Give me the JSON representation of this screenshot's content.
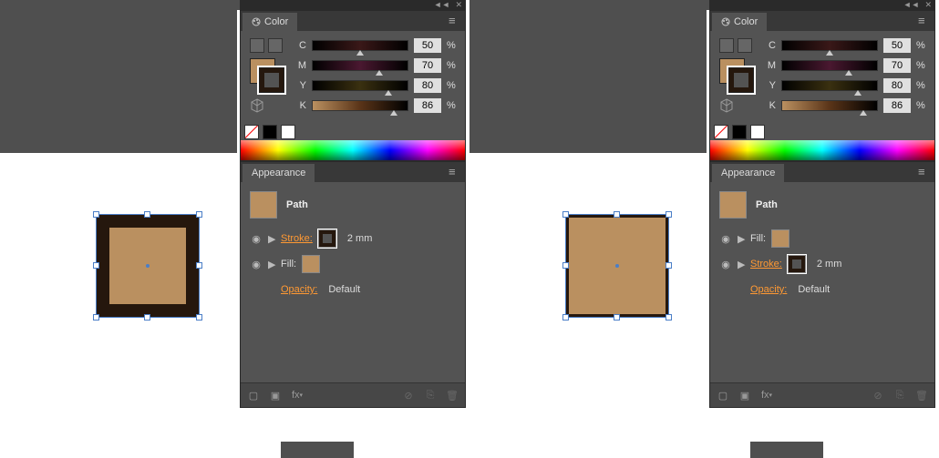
{
  "panels": {
    "color": {
      "title": "Color",
      "channels": [
        {
          "label": "C",
          "value": "50",
          "pct": "%",
          "pos": 50
        },
        {
          "label": "M",
          "value": "70",
          "pct": "%",
          "pos": 70
        },
        {
          "label": "Y",
          "value": "80",
          "pct": "%",
          "pos": 80
        },
        {
          "label": "K",
          "value": "86",
          "pct": "%",
          "pos": 86
        }
      ]
    },
    "appearance": {
      "title": "Appearance",
      "object_type": "Path",
      "opacity_label": "Opacity:",
      "opacity_value": "Default",
      "stroke_label": "Stroke:",
      "fill_label": "Fill:",
      "stroke_weight": "2 mm",
      "fx_label": "fx"
    }
  },
  "left_view": {
    "order": "stroke_first",
    "active_proxy": "stroke"
  },
  "right_view": {
    "order": "fill_first",
    "active_proxy": "stroke"
  }
}
